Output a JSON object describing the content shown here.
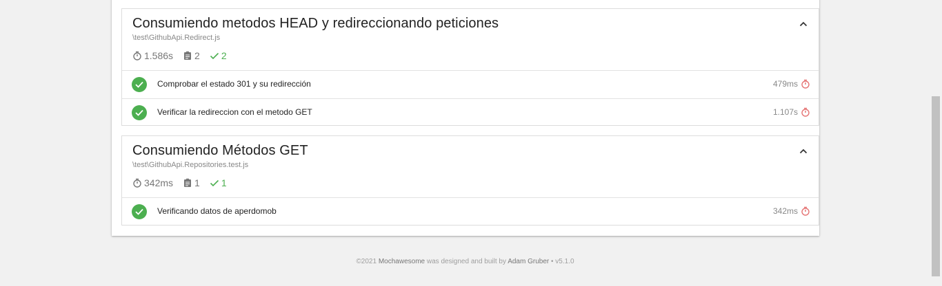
{
  "suites": [
    {
      "title": "Consumiendo metodos HEAD y redireccionando peticiones",
      "file": "\\test\\GithubApi.Redirect.js",
      "duration": "1.586s",
      "tests_count": "2",
      "passed_count": "2",
      "tests": [
        {
          "title": "Comprobar el estado 301 y su redirección",
          "duration": "479ms"
        },
        {
          "title": "Verificar la redireccion con el metodo GET",
          "duration": "1.107s"
        }
      ]
    },
    {
      "title": "Consumiendo Métodos GET",
      "file": "\\test\\GithubApi.Repositories.test.js",
      "duration": "342ms",
      "tests_count": "1",
      "passed_count": "1",
      "tests": [
        {
          "title": "Verificando datos de aperdomob",
          "duration": "342ms"
        }
      ]
    }
  ],
  "footer": {
    "copyright": "©2021",
    "product": "Mochawesome",
    "middle": " was designed and built by ",
    "author": "Adam Gruber",
    "version": " • v5.1.0"
  },
  "colors": {
    "pass": "#4caf50",
    "slow_timer": "#e57373",
    "chevron": "#333333"
  },
  "icons": {
    "chevron": "chevron-up-icon",
    "duration": "stopwatch-icon",
    "tests": "clipboard-icon",
    "passed": "check-icon",
    "test_status": "check-circle-icon",
    "test_timer": "timer-icon"
  }
}
